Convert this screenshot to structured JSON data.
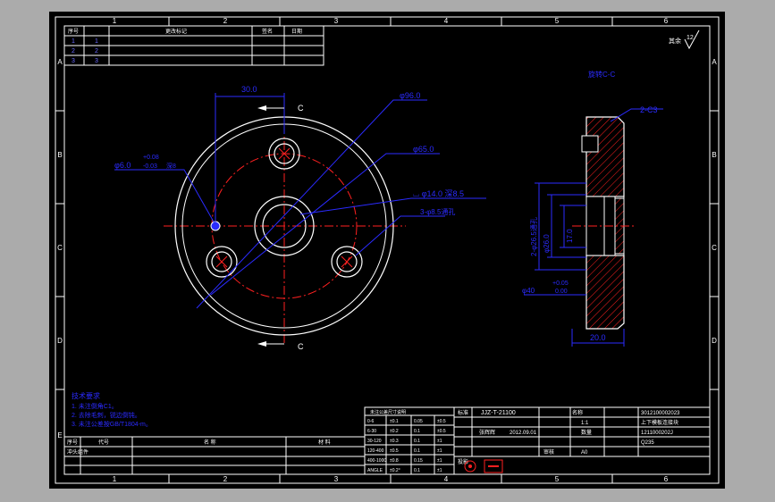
{
  "colors": {
    "background": "#000000",
    "border": "#ffffff",
    "dimension": "#2b2bff",
    "centerline": "#ff2020",
    "hatch": "#ff2020",
    "titleblock_text": "#ffffff"
  },
  "border_columns": [
    "1",
    "2",
    "3",
    "4",
    "5",
    "6"
  ],
  "border_rows": [
    "A",
    "B",
    "C",
    "D",
    "E"
  ],
  "revision_table": {
    "headers": [
      "序号",
      "",
      "更改标记",
      "签名",
      "日期"
    ],
    "rows": [
      [
        "1",
        "1"
      ],
      [
        "2",
        "2"
      ],
      [
        "3",
        "3"
      ]
    ]
  },
  "surface_finish": "其余",
  "front_view": {
    "dims": {
      "offset": "30.0",
      "outer_dia": "φ96.0",
      "bolt_circle": "φ65.0",
      "pin_hole": "φ6.0",
      "pin_tol_upper": "+0.08",
      "pin_tol_lower": "-0.03",
      "pin_suffix": "深8",
      "counterbore": "⌴ φ14.0 深8.5",
      "through_holes": "3-φ8.5通孔"
    },
    "section_label": "C"
  },
  "section_view": {
    "title": "旋转C-C",
    "chamfer": "2-C3",
    "dims": {
      "d1": "2-φ26.5通孔",
      "d2": "φ26.0",
      "d3": "17.0",
      "tol_upper": "+0.05",
      "tol_lower": "0.00",
      "d4": "φ40",
      "width": "20.0"
    }
  },
  "notes": {
    "title": "技术要求",
    "lines": [
      "1. 未注倒角C1。",
      "2. 去除毛刺，锐边倒钝。",
      "3. 未注公差按GB/T1804-m。"
    ]
  },
  "title_block": {
    "drawing_no": "JJZ-T-21100",
    "part_no": "3012100002023",
    "part_name": "上下模板连接块",
    "material_no": "1211000202J",
    "date": "2012.09.01",
    "scale": "1:1",
    "sheet": "A0",
    "material": "Q235",
    "designer": "张辉辉",
    "reviewer": "审核",
    "name_cell": "名称",
    "qty_label": "数量",
    "proj": "投影",
    "stamp_label": "标准"
  },
  "tolerance_table": {
    "rows": [
      [
        "0-6",
        "±0.1",
        "0.05",
        "±0.5"
      ],
      [
        "6-30",
        "±0.2",
        "0.1",
        "±0.5"
      ],
      [
        "30-120",
        "±0.3",
        "0.1",
        "±1"
      ],
      [
        "120-400",
        "±0.5",
        "0.1",
        "±1"
      ],
      [
        "400-1000",
        "±0.8",
        "0.15",
        "±1"
      ],
      [
        "ANGLE",
        "±0.2°",
        "0.1",
        "±1"
      ]
    ],
    "header": "未注公差尺寸说明"
  },
  "parts_list": {
    "headers": [
      "序号",
      "代号",
      "名 称",
      "材 料"
    ],
    "row": [
      "",
      "冲头组件",
      "",
      ""
    ]
  }
}
